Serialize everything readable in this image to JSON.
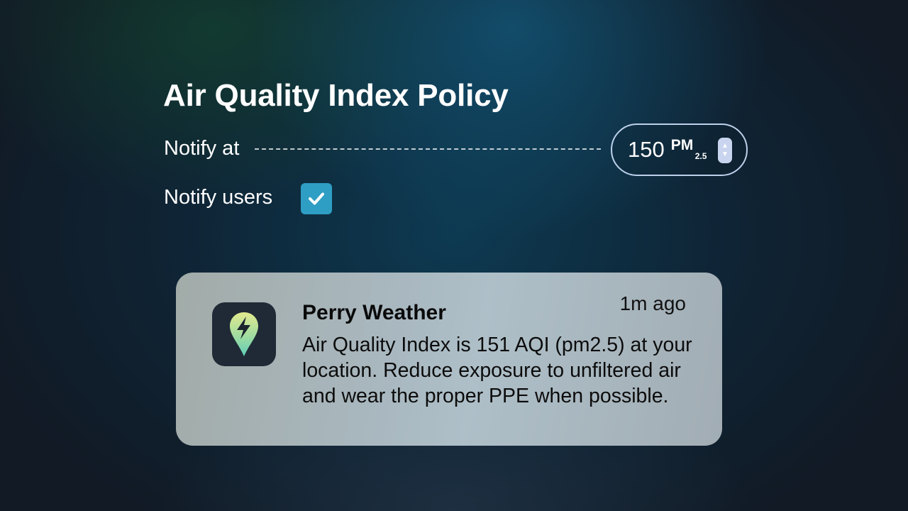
{
  "policy": {
    "title": "Air Quality Index Policy",
    "notify_at_label": "Notify at",
    "threshold_value": "150",
    "unit_main": "PM",
    "unit_sub": "2.5",
    "notify_users_label": "Notify users",
    "notify_users_checked": true
  },
  "notification": {
    "app_name": "Perry Weather",
    "time": "1m ago",
    "body": "Air Quality Index is 151 AQI (pm2.5) at your location. Reduce exposure to unfiltered air and wear the proper PPE when possible.",
    "icon": "lightning-pin-icon"
  },
  "colors": {
    "checkbox": "#2e9ec4",
    "pill_border": "#bcd0ea",
    "card_bg": "#aebfc8",
    "app_icon_bg": "#1f2a36"
  }
}
